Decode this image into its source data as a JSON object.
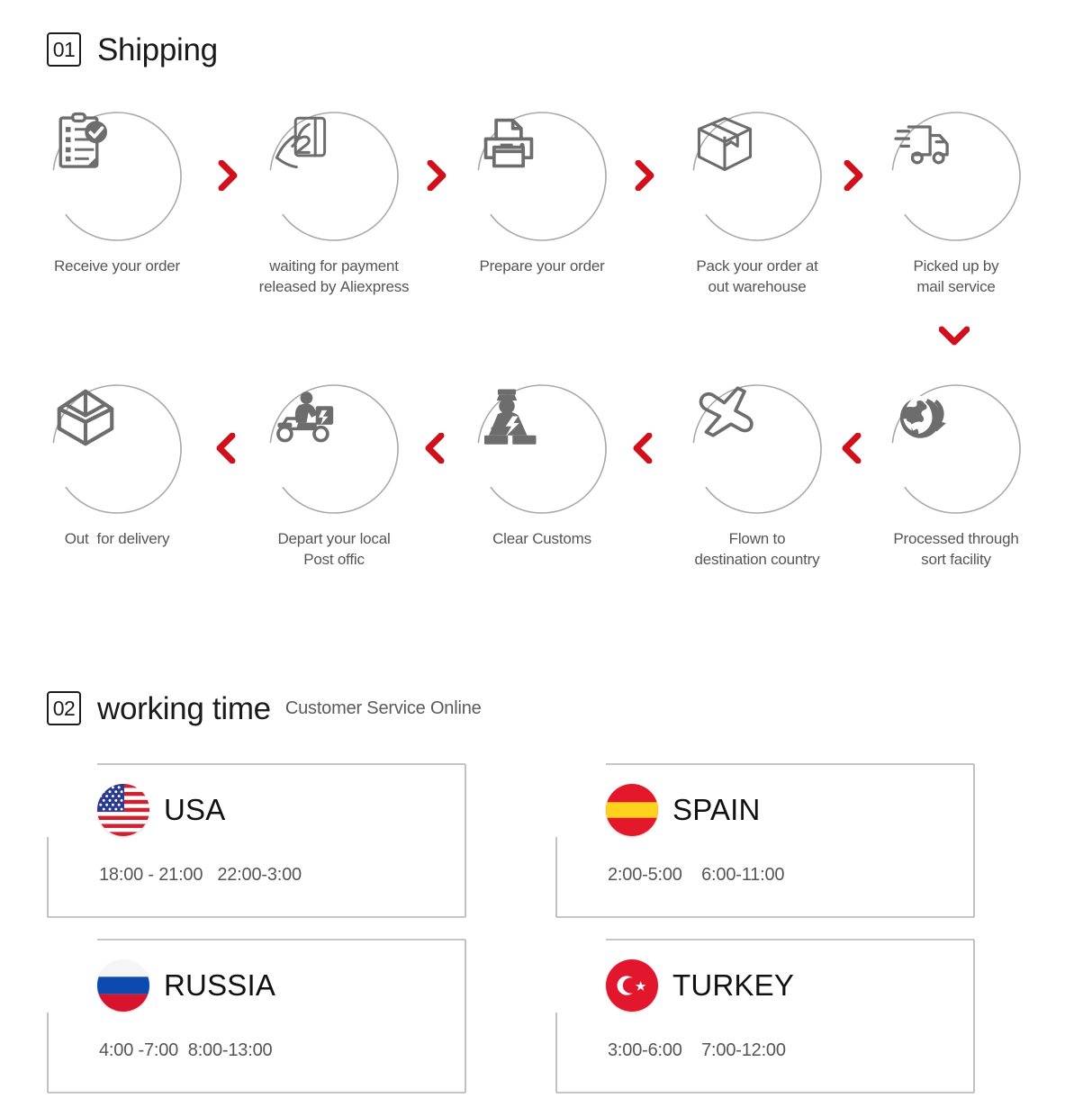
{
  "sections": [
    {
      "number": "01",
      "title": "Shipping",
      "subtitle": ""
    },
    {
      "number": "02",
      "title": "working time",
      "subtitle": "Customer Service Online"
    }
  ],
  "shipping": {
    "row1": [
      {
        "label": "Receive your order",
        "icon": "clipboard-check-icon"
      },
      {
        "label": "waiting for payment\nreleased by Aliexpress",
        "icon": "hand-card-icon"
      },
      {
        "label": "Prepare your order",
        "icon": "printer-icon"
      },
      {
        "label": "Pack your order at\nout warehouse",
        "icon": "box-icon"
      },
      {
        "label": "Picked up by\nmail service",
        "icon": "delivery-truck-icon"
      }
    ],
    "row2": [
      {
        "label": "Out  for delivery",
        "icon": "open-box-icon"
      },
      {
        "label": "Depart your local\nPost offic",
        "icon": "scooter-courier-icon"
      },
      {
        "label": "Clear Customs",
        "icon": "customs-officer-icon"
      },
      {
        "label": "Flown to\ndestination country",
        "icon": "airplane-icon"
      },
      {
        "label": "Processed through\nsort facility",
        "icon": "globe-arrow-icon"
      }
    ],
    "arrow_right": "chevron-right-icon",
    "arrow_left": "chevron-left-icon",
    "arrow_down": "chevron-down-icon",
    "arrow_color": "#d0111b",
    "circle_color": "#a8a8a8",
    "icon_color": "#6d6d6d"
  },
  "working_time": {
    "cards": [
      {
        "country": "USA",
        "flag": "flag-usa-icon",
        "hours": "18:00 - 21:00   22:00-3:00"
      },
      {
        "country": "SPAIN",
        "flag": "flag-spain-icon",
        "hours": "2:00-5:00    6:00-11:00"
      },
      {
        "country": "RUSSIA",
        "flag": "flag-russia-icon",
        "hours": "4:00 -7:00  8:00-13:00"
      },
      {
        "country": "TURKEY",
        "flag": "flag-turkey-icon",
        "hours": "3:00-6:00    7:00-12:00"
      }
    ],
    "card_border_color": "#b3b3b3"
  }
}
